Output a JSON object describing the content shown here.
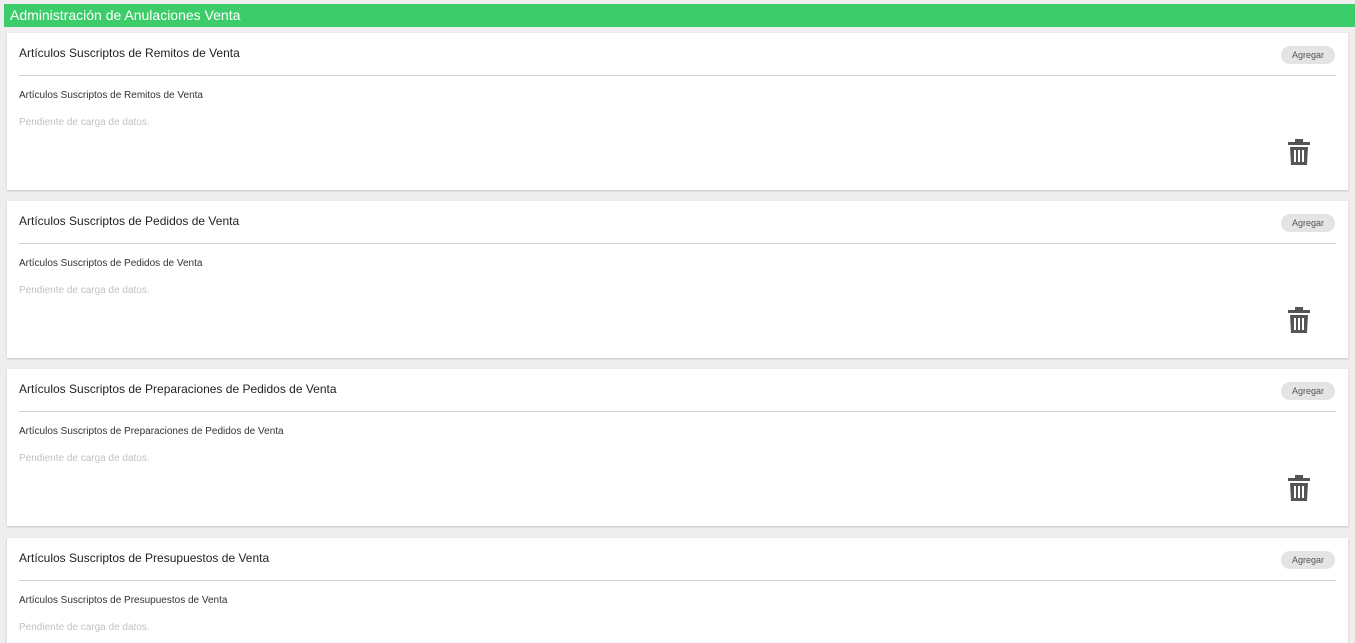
{
  "header": {
    "title": "Administración de Anulaciones Venta"
  },
  "cards": [
    {
      "title": "Artículos Suscriptos de Remitos de Venta",
      "add_label": "Agregar",
      "subtitle": "Artículos Suscriptos de Remitos de Venta",
      "status": "Pendiente de carga de datos.",
      "delete_icon": "trash-icon"
    },
    {
      "title": "Artículos Suscriptos de Pedidos de Venta",
      "add_label": "Agregar",
      "subtitle": "Artículos Suscriptos de Pedidos de Venta",
      "status": "Pendiente de carga de datos.",
      "delete_icon": "trash-icon"
    },
    {
      "title": "Artículos Suscriptos de Preparaciones de Pedidos de Venta",
      "add_label": "Agregar",
      "subtitle": "Artículos Suscriptos de Preparaciones de Pedidos de Venta",
      "status": "Pendiente de carga de datos.",
      "delete_icon": "trash-icon"
    },
    {
      "title": "Artículos Suscriptos de Presupuestos de Venta",
      "add_label": "Agregar",
      "subtitle": "Artículos Suscriptos de Presupuestos de Venta",
      "status": "Pendiente de carga de datos."
    }
  ],
  "colors": {
    "header_bg": "#3ccd6a",
    "icon": "#555555",
    "pending_text": "#c2c2c2"
  }
}
